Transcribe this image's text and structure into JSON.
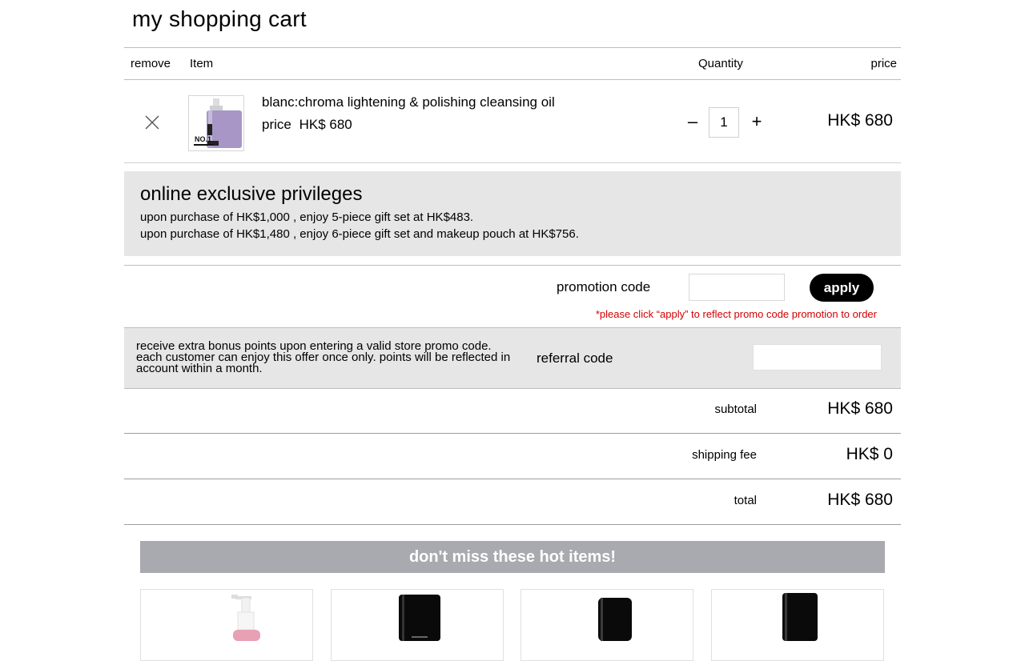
{
  "cart": {
    "title": "my shopping cart",
    "headers": {
      "remove": "remove",
      "item": "Item",
      "quantity": "Quantity",
      "price": "price"
    },
    "items": [
      {
        "name": "blanc:chroma lightening & polishing cleansing oil",
        "price_label": "price",
        "price": "HK$ 680",
        "quantity": "1",
        "line_total": "HK$ 680",
        "thumb_text": "NO.1"
      }
    ],
    "qty_minus": "–",
    "qty_plus": "+"
  },
  "privileges": {
    "title": "online exclusive privileges",
    "lines": [
      "upon purchase of HK$1,000 , enjoy 5-piece gift set at HK$483.",
      "upon purchase of HK$1,480 , enjoy 6-piece gift set and makeup pouch at HK$756."
    ]
  },
  "promo": {
    "label": "promotion code",
    "value": "",
    "apply": "apply",
    "note": "*please click “apply” to reflect promo code promotion to order"
  },
  "referral": {
    "description": "receive extra bonus points upon entering a valid store promo code. each customer can enjoy this offer once only. points will be reflected in account within a month.",
    "label": "referral code",
    "value": ""
  },
  "summary": {
    "subtotal_label": "subtotal",
    "subtotal": "HK$ 680",
    "shipping_label": "shipping fee",
    "shipping": "HK$ 0",
    "total_label": "total",
    "total": "HK$ 680"
  },
  "hot": {
    "title": "don't miss these hot items!"
  },
  "colors": {
    "accent": "#000000",
    "promo_note": "#d40000",
    "banner": "#a9a9b0",
    "panel": "#e6e6e6"
  }
}
